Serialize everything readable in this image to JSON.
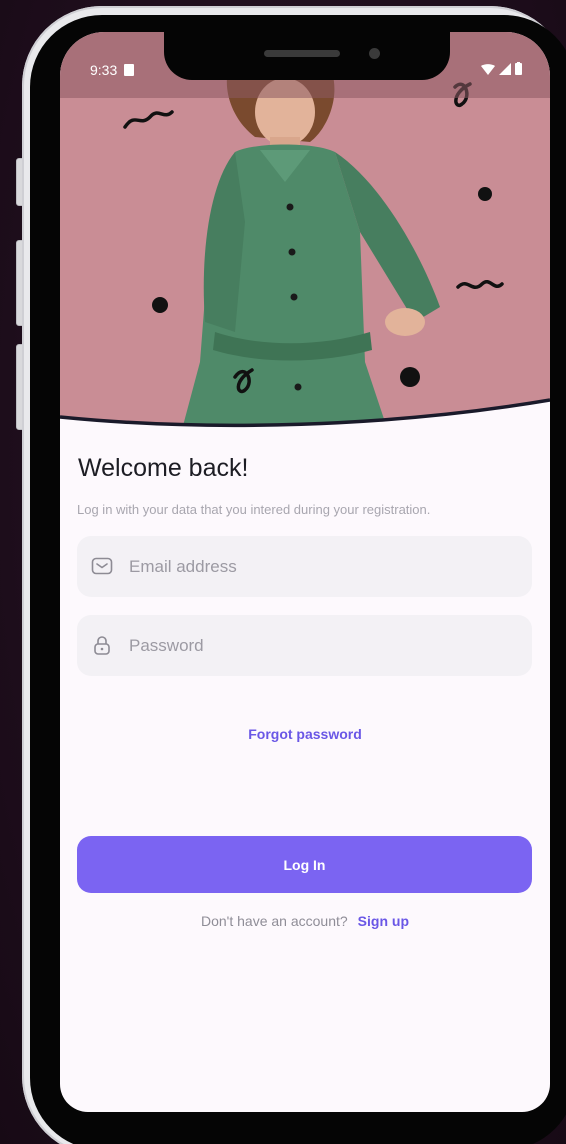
{
  "status_bar": {
    "time": "9:33"
  },
  "login": {
    "title": "Welcome back!",
    "subtitle": "Log in with your data that you intered during your registration.",
    "email_placeholder": "Email address",
    "password_placeholder": "Password",
    "forgot_label": "Forgot password",
    "login_button": "Log In",
    "no_account_text": "Don't have an account?",
    "signup_label": "Sign up"
  },
  "icons": {
    "email": "mail-icon",
    "password": "lock-icon",
    "wifi": "wifi-icon",
    "cellular": "cellular-signal-icon",
    "battery": "battery-icon",
    "sim": "sim-card-icon"
  },
  "colors": {
    "hero_background": "#c98d95",
    "accent": "#7b64f2",
    "link": "#6a57e6",
    "field_background": "#f3f1f5",
    "screen_background": "#fdf9fd",
    "outer_background": "#1d0d1b",
    "dress": "#4f8a69"
  }
}
